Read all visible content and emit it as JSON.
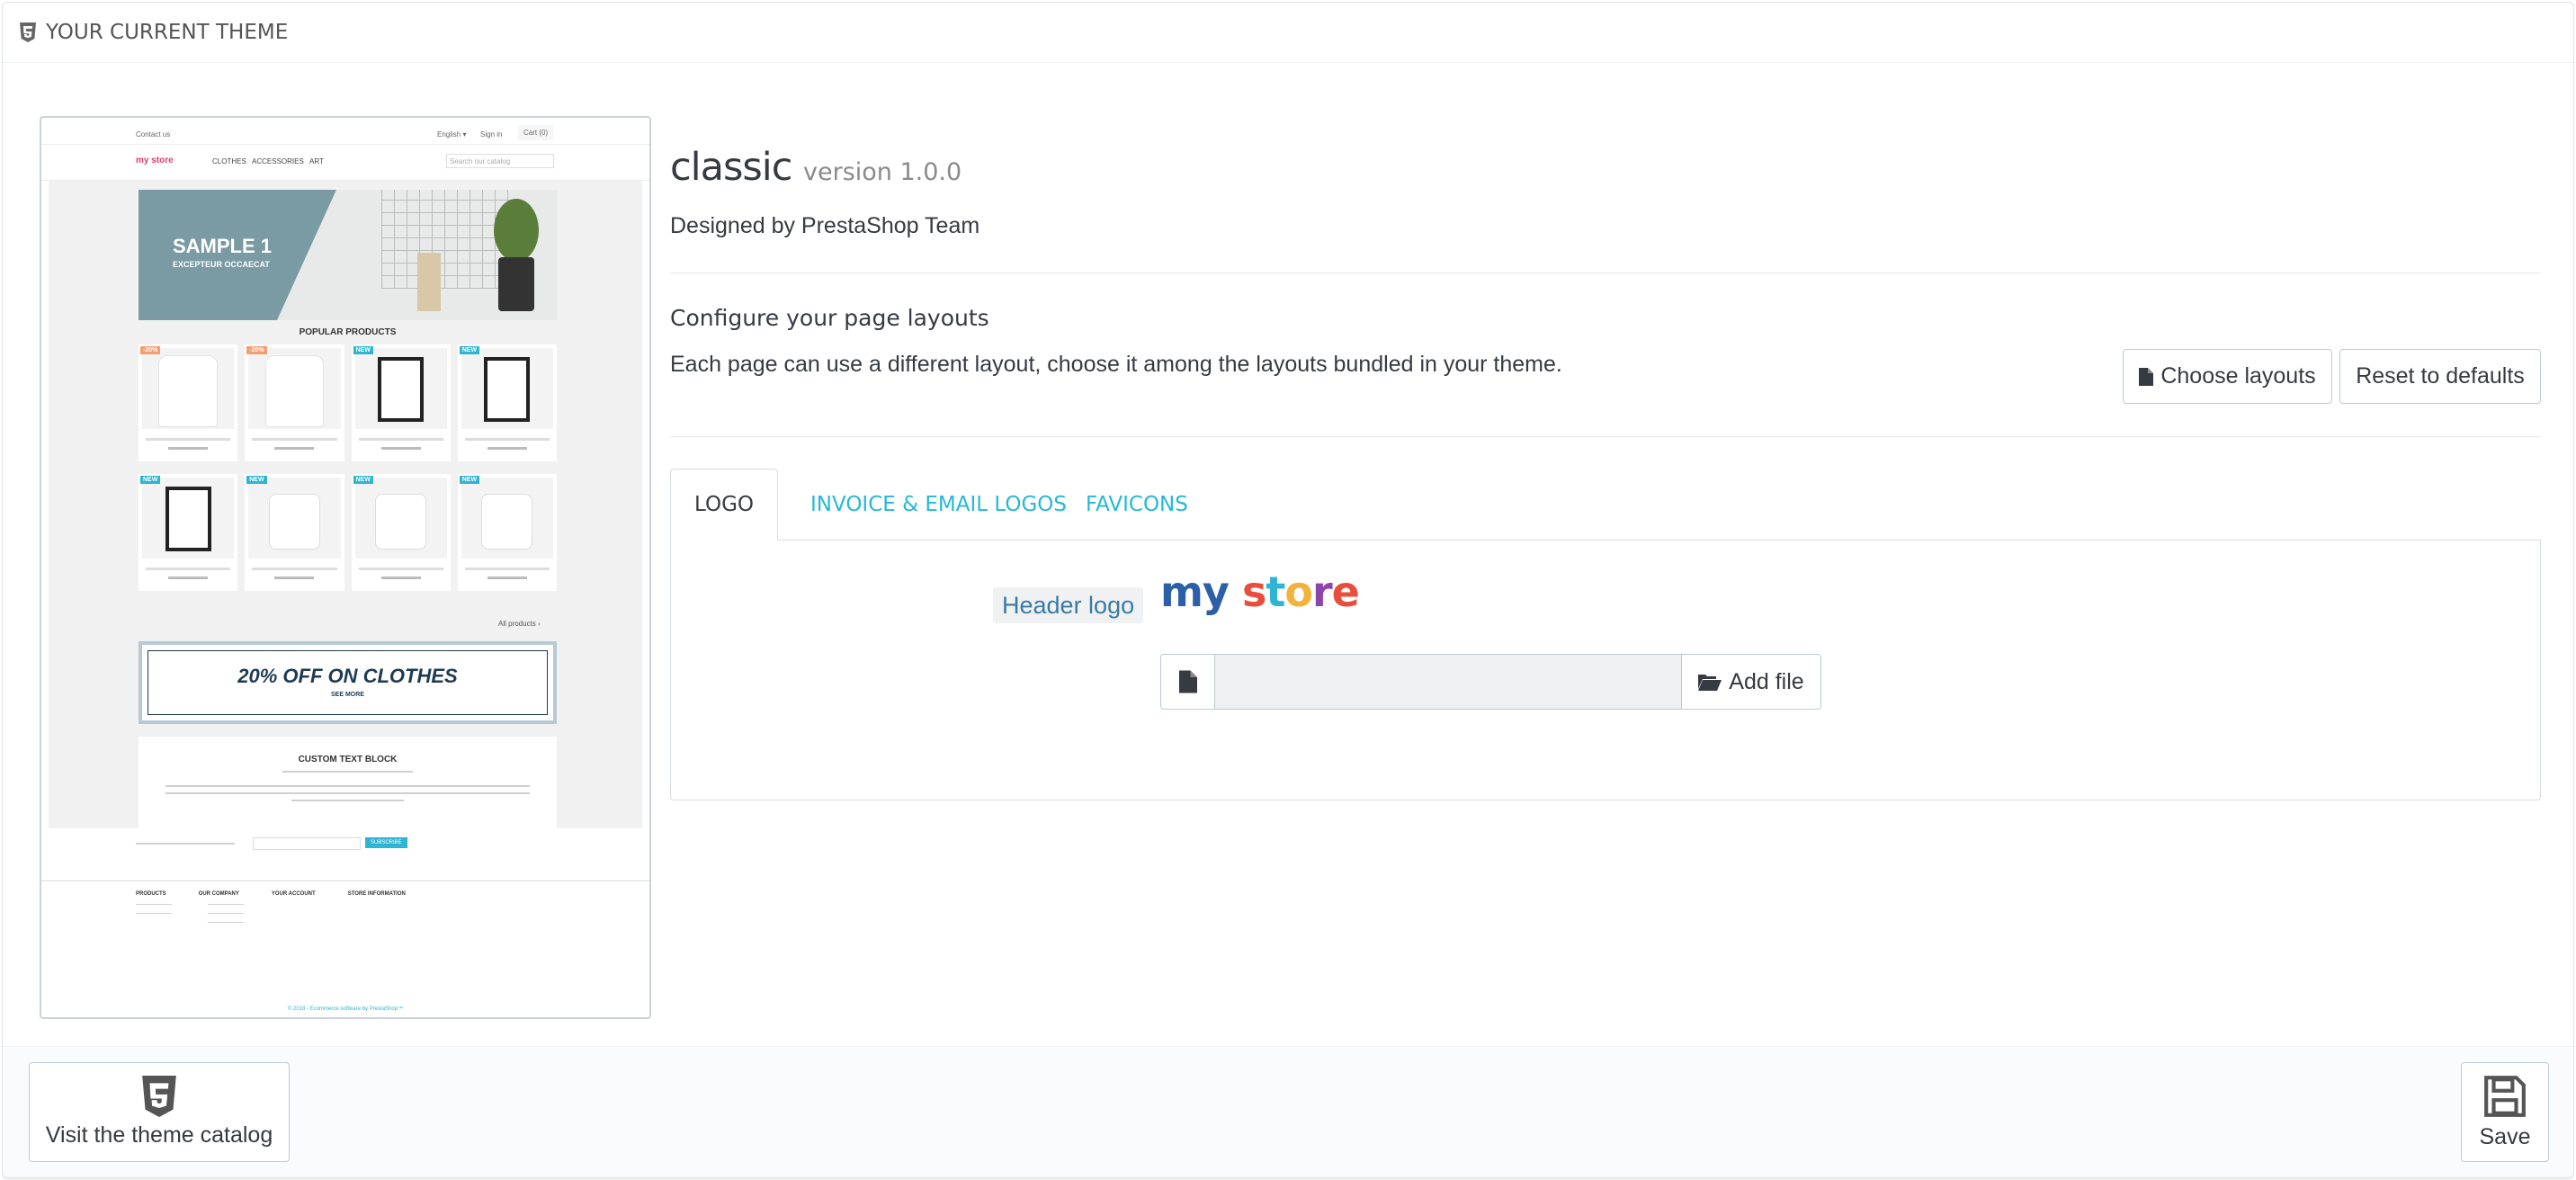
{
  "panel": {
    "heading": "YOUR CURRENT THEME",
    "heading_icon": "html5-icon"
  },
  "preview": {
    "top_left": "Contact us",
    "lang": "English ▾",
    "signin": "Sign in",
    "cart": "Cart (0)",
    "logo": "my store",
    "menu": "CLOTHES   ACCESSORIES   ART",
    "search_placeholder": "Search our catalog",
    "slider_title": "SAMPLE 1",
    "slider_sub": "EXCEPTEUR OCCAECAT",
    "section_title": "POPULAR PRODUCTS",
    "all_products": "All products ›",
    "banner_main": "20% OFF ON CLOTHES",
    "banner_sub": "SEE MORE",
    "text_title": "CUSTOM TEXT BLOCK",
    "newsletter_btn": "SUBSCRIBE",
    "foot_cols": [
      "PRODUCTS",
      "OUR COMPANY",
      "YOUR ACCOUNT",
      "STORE INFORMATION"
    ],
    "copyright": "© 2018 - Ecommerce software by PrestaShop™"
  },
  "theme": {
    "name": "classic",
    "version": "version 1.0.0",
    "designed_by": "Designed by PrestaShop Team"
  },
  "layouts": {
    "title": "Configure your page layouts",
    "description": "Each page can use a different layout, choose it among the layouts bundled in your theme.",
    "choose_label": "Choose layouts",
    "reset_label": "Reset to defaults"
  },
  "tabs": [
    {
      "label": "LOGO",
      "active": true
    },
    {
      "label": "INVOICE & EMAIL LOGOS",
      "active": false
    },
    {
      "label": "FAVICONS",
      "active": false
    }
  ],
  "logo_tab": {
    "header_logo_label": "Header logo",
    "logo_text": "my store",
    "add_file_label": "Add file",
    "file_value": ""
  },
  "footer": {
    "catalog_label": "Visit the theme catalog",
    "save_label": "Save"
  },
  "colors": {
    "accent": "#25b9d7",
    "text": "#363a41",
    "border": "#bbcdd2"
  }
}
